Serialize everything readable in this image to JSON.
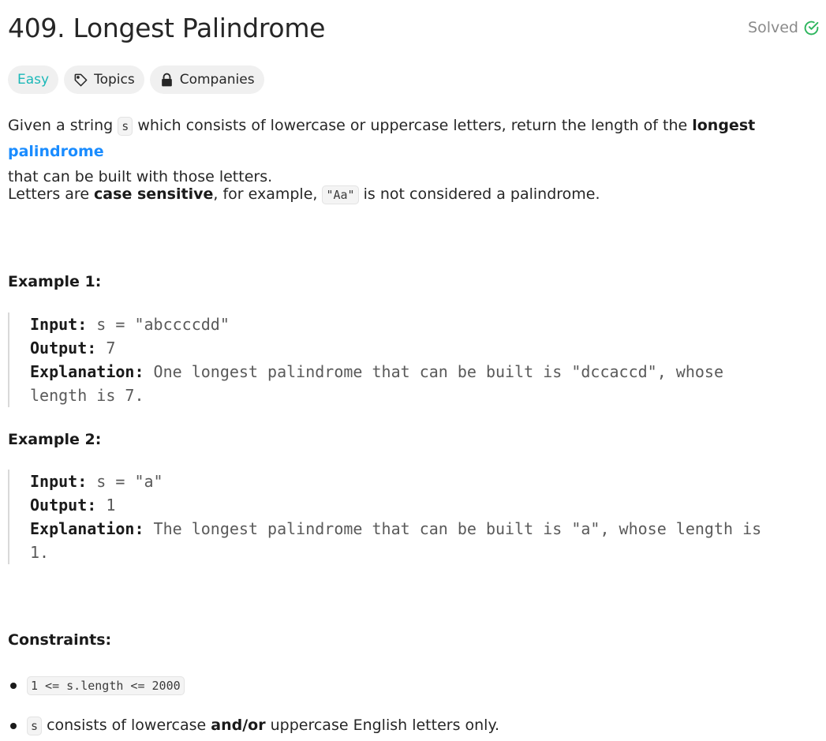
{
  "problem": {
    "title": "409. Longest Palindrome",
    "status": "Solved",
    "difficulty": "Easy",
    "tags": {
      "topics": "Topics",
      "companies": "Companies"
    }
  },
  "description": {
    "p1_a": "Given a string ",
    "p1_code": "s",
    "p1_b": " which consists of lowercase or uppercase letters, return the length of the ",
    "p1_bold": "longest",
    "p1_link": "palindrome",
    "p1_c": " that can be built with those letters.",
    "p2_a": "Letters are ",
    "p2_bold": "case sensitive",
    "p2_b": ", for example, ",
    "p2_code": "\"Aa\"",
    "p2_c": " is not considered a palindrome."
  },
  "examples": [
    {
      "heading": "Example 1:",
      "input_label": "Input:",
      "input": " s = \"abccccdd\"",
      "output_label": "Output:",
      "output": " 7",
      "explanation_label": "Explanation:",
      "explanation_line1": " One longest palindrome that can be built is \"dccaccd\", whose",
      "explanation_line2": "length is 7."
    },
    {
      "heading": "Example 2:",
      "input_label": "Input:",
      "input": " s = \"a\"",
      "output_label": "Output:",
      "output": " 1",
      "explanation_label": "Explanation:",
      "explanation_line1": " The longest palindrome that can be built is \"a\", whose length is",
      "explanation_line2": "1."
    }
  ],
  "constraints": {
    "heading": "Constraints:",
    "c1_code": "1 <= s.length <= 2000",
    "c2_code": "s",
    "c2_a": " consists of lowercase ",
    "c2_bold": "and/or",
    "c2_b": " uppercase English letters only."
  },
  "colors": {
    "easy": "#1cb8b8",
    "link": "#1a8cff",
    "solved_check": "#2db55d"
  },
  "icons": {
    "solved": "check-circle-icon",
    "topics": "tag-icon",
    "companies": "lock-icon"
  }
}
